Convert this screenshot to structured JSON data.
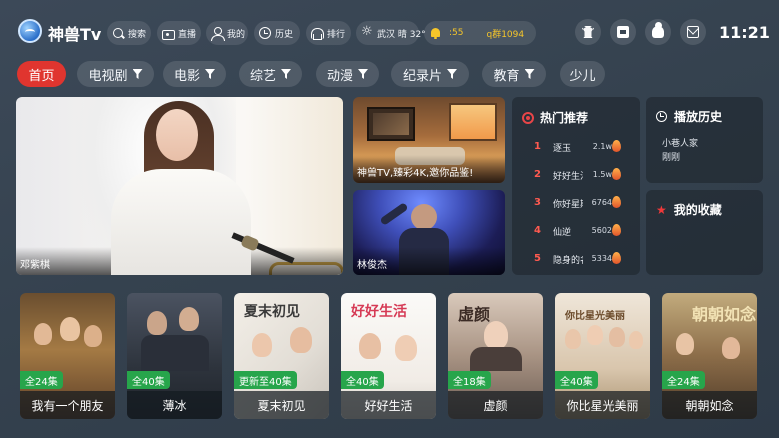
{
  "header": {
    "app_title": "神兽Tv",
    "nav": [
      {
        "label": "搜索",
        "icon": "search-icon"
      },
      {
        "label": "直播",
        "icon": "live-tv-icon"
      },
      {
        "label": "我的",
        "icon": "user-icon"
      },
      {
        "label": "历史",
        "icon": "history-icon"
      },
      {
        "label": "排行",
        "icon": "ranking-icon"
      }
    ],
    "weather": {
      "label": "武汉 晴 32°",
      "icon": "sun-icon"
    },
    "notice": {
      "part_a": ":55",
      "part_b": "q群1094",
      "icon": "bell-icon"
    },
    "actions": [
      {
        "name": "skin-icon"
      },
      {
        "name": "printer-icon"
      },
      {
        "name": "cloud-icon"
      },
      {
        "name": "mail-icon"
      }
    ],
    "clock": "11:21"
  },
  "tabs": [
    {
      "label": "首页",
      "filter": false,
      "active": true
    },
    {
      "label": "电视剧",
      "filter": true
    },
    {
      "label": "电影",
      "filter": true
    },
    {
      "label": "综艺",
      "filter": true
    },
    {
      "label": "动漫",
      "filter": true
    },
    {
      "label": "纪录片",
      "filter": true
    },
    {
      "label": "教育",
      "filter": true
    },
    {
      "label": "少儿",
      "filter": false
    }
  ],
  "featured": {
    "hero_caption": "邓紫棋",
    "promo_caption": "神兽TV,臻彩4K,邀你品鉴!",
    "concert_caption": "林俊杰"
  },
  "hot": {
    "title": "热门推荐",
    "items": [
      {
        "rank": "1",
        "title": "逐玉",
        "views": "2.1w"
      },
      {
        "rank": "2",
        "title": "好好生活",
        "views": "1.5w"
      },
      {
        "rank": "3",
        "title": "你好星期六",
        "views": "6764"
      },
      {
        "rank": "4",
        "title": "仙逆",
        "views": "5602"
      },
      {
        "rank": "5",
        "title": "隐身的名字",
        "views": "5334"
      }
    ]
  },
  "history": {
    "title": "播放历史",
    "items": [
      "小巷人家",
      "刚刚"
    ]
  },
  "favorites": {
    "title": "我的收藏"
  },
  "posters": [
    {
      "title": "我有一个朋友",
      "badge": "全24集",
      "art": "我有一个朋友"
    },
    {
      "title": "薄冰",
      "badge": "全40集",
      "art": "薄冰"
    },
    {
      "title": "夏末初见",
      "badge": "更新至40集",
      "art": "夏末初见"
    },
    {
      "title": "好好生活",
      "badge": "全40集",
      "art": "好好生活"
    },
    {
      "title": "虚颜",
      "badge": "全18集",
      "art": "虚颜"
    },
    {
      "title": "你比星光美丽",
      "badge": "全40集",
      "art": "你比星光美丽"
    },
    {
      "title": "朝朝如念",
      "badge": "全24集",
      "art": "朝朝如念"
    }
  ],
  "colors": {
    "accent_red": "#e0352f",
    "badge_green": "#27a54b",
    "notice_yellow": "#f6c62a",
    "background": "#36434f"
  }
}
